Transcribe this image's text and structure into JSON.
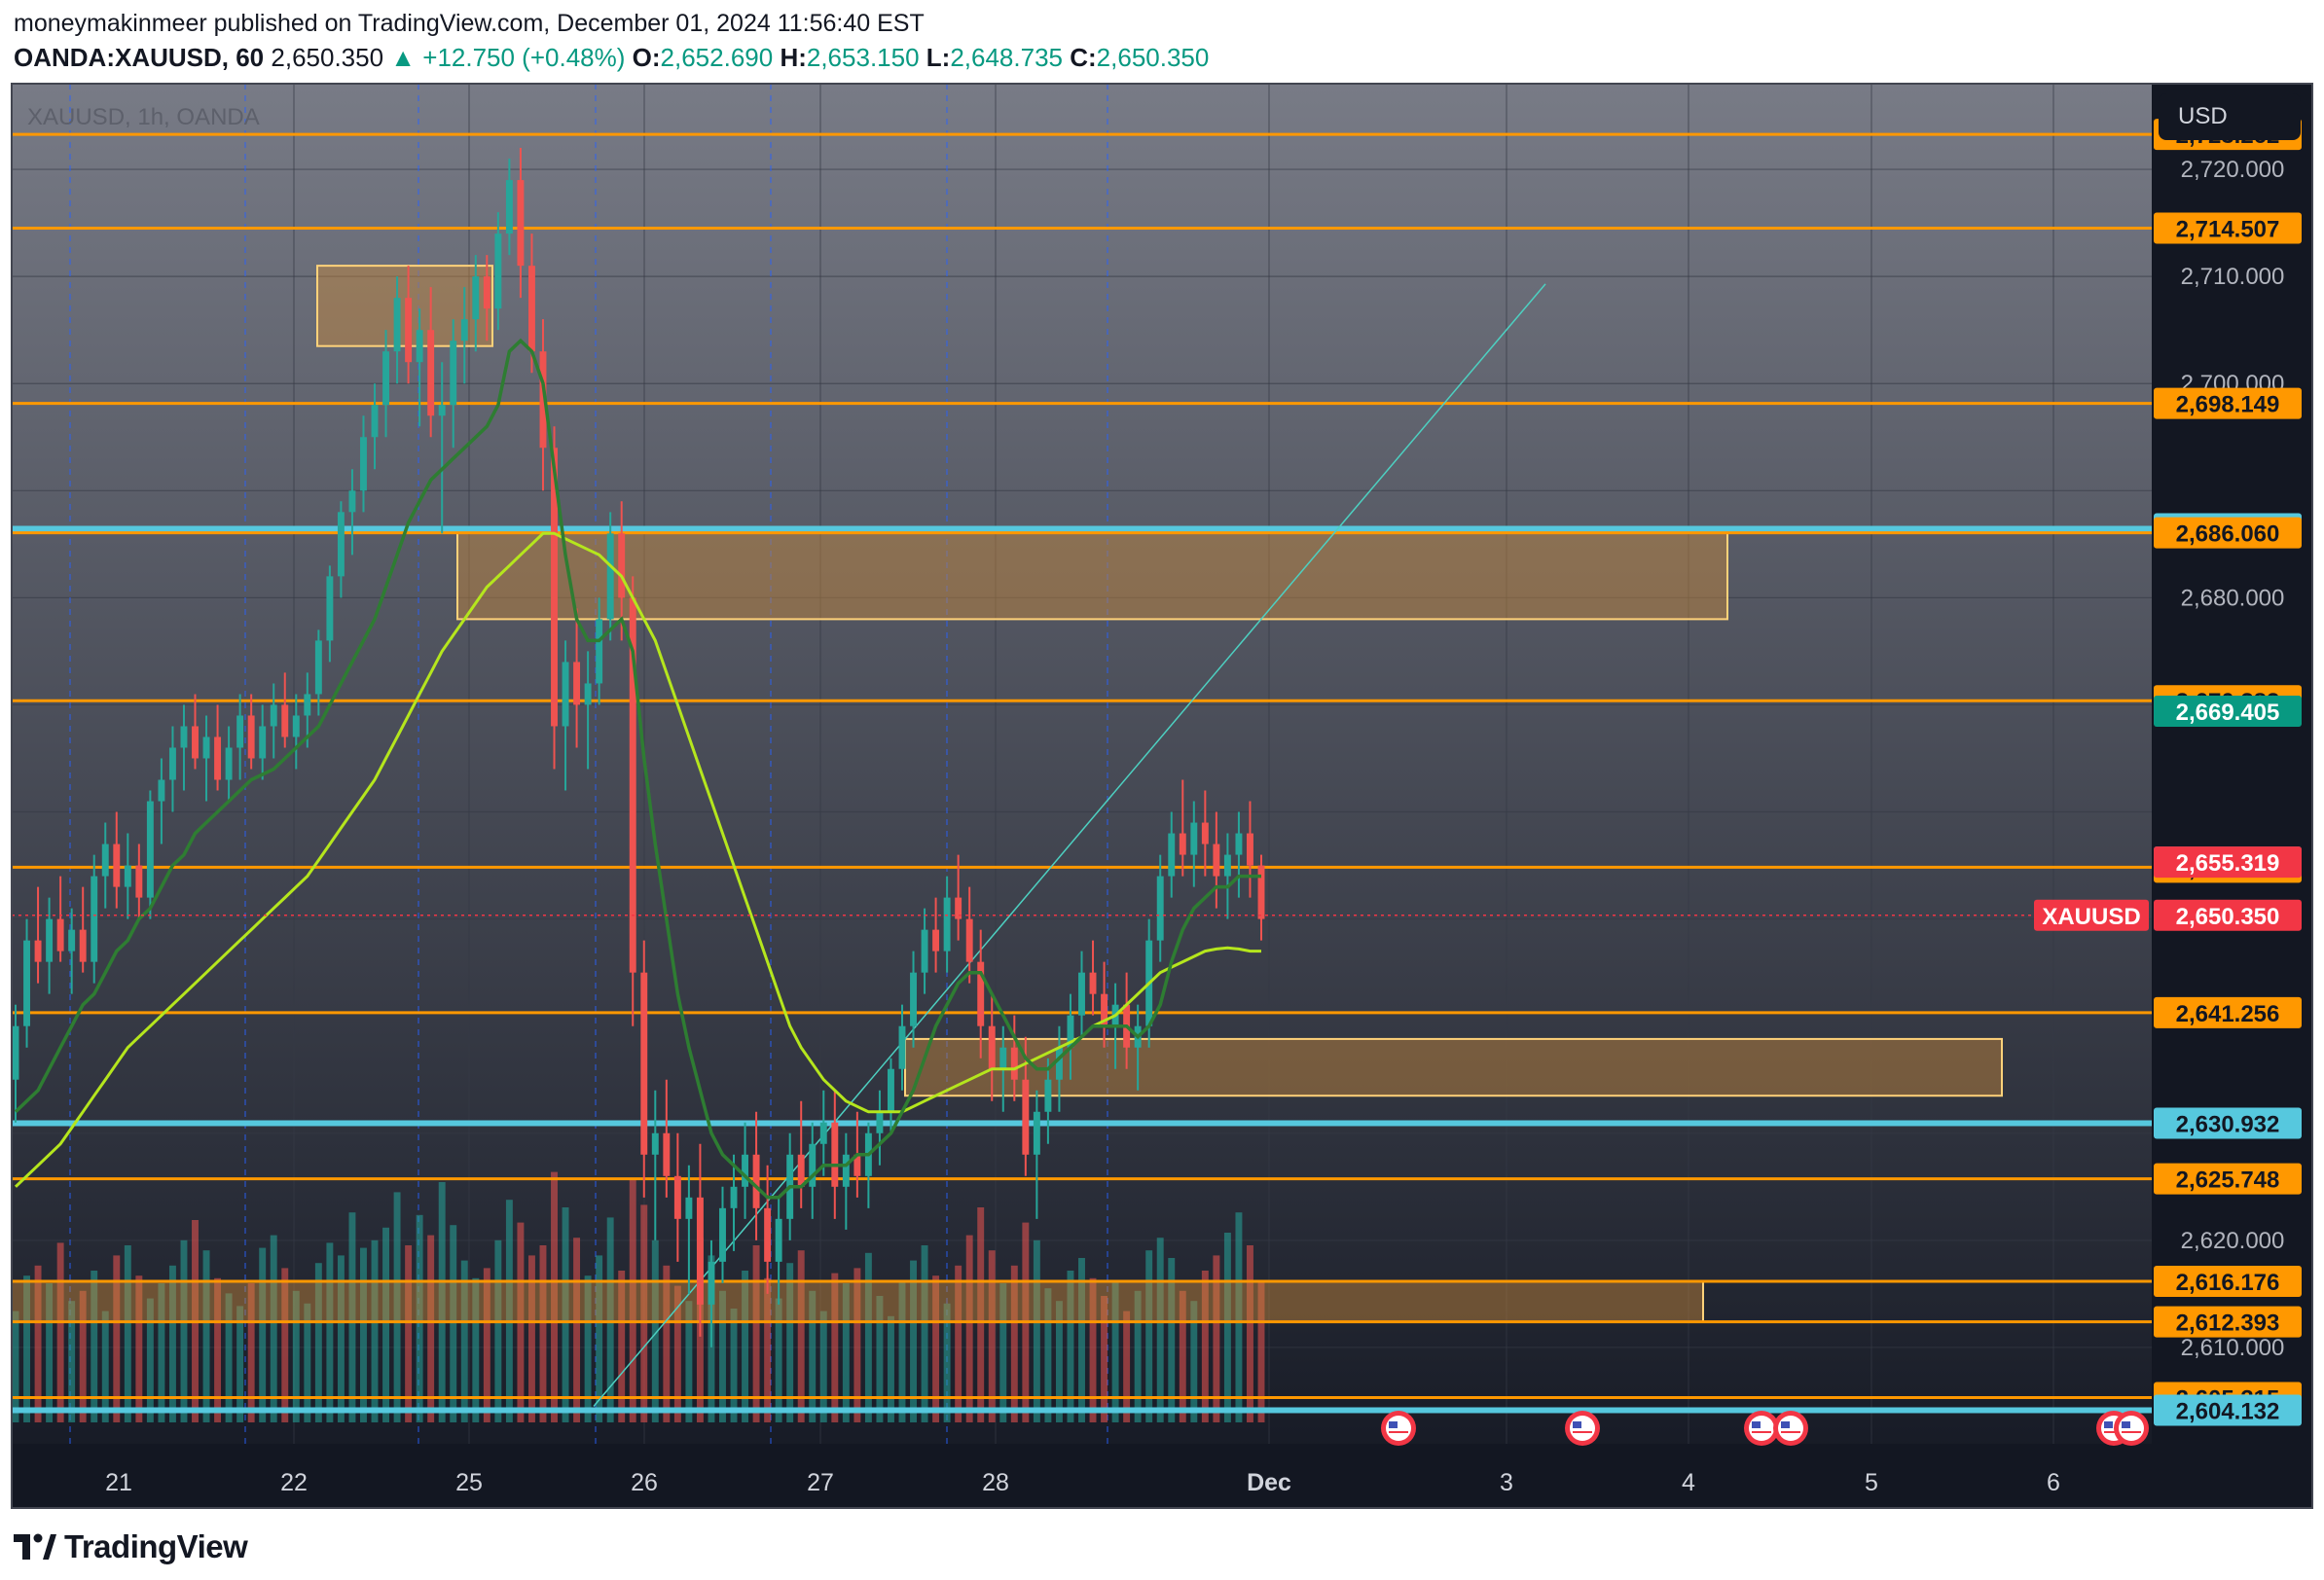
{
  "header": {
    "published": "moneymakinmeer published on TradingView.com, December 01, 2024 11:56:40 EST",
    "symbol": "OANDA:XAUUSD, 60",
    "last": "2,650.350",
    "change": "▲ +12.750 (+0.48%)",
    "o_label": "O:",
    "o_val": "2,652.690",
    "h_label": "H:",
    "h_val": "2,653.150",
    "l_label": "L:",
    "l_val": "2,648.735",
    "c_label": "C:",
    "c_val": "2,650.350"
  },
  "legend": {
    "title": "XAUUSD, 1h, OANDA"
  },
  "currency_button": "USD",
  "branding": {
    "logo_text": "TradingView"
  },
  "chart_data": {
    "type": "candlestick",
    "symbol": "XAUUSD",
    "interval": "1h",
    "broker": "OANDA",
    "colors": {
      "background_top": "#787b86",
      "background_bottom": "#131722",
      "up": "#26a69a",
      "down": "#ef5350",
      "support_line": "#ff9800",
      "key_line": "#56c8de",
      "zone": "#c9893b",
      "ma_fast": "#2e7d32",
      "ma_slow": "#b5e61d",
      "trendline": "#4dd0c1"
    },
    "ylim": [
      2601,
      2728
    ],
    "x_axis_labels": [
      "21",
      "22",
      "25",
      "26",
      "27",
      "28",
      "Dec",
      "3",
      "4",
      "5",
      "6"
    ],
    "y_axis_ticks": [
      "2,720.000",
      "2,710.000",
      "2,700.000",
      "2,680.000",
      "2,620.000",
      "2,610.000"
    ],
    "horizontal_levels": [
      {
        "label": "2,723.262",
        "value": 2723.262,
        "color": "#ff9800"
      },
      {
        "label": "2,714.507",
        "value": 2714.507,
        "color": "#ff9800"
      },
      {
        "label": "2,698.149",
        "value": 2698.149,
        "color": "#ff9800"
      },
      {
        "label": "2,686.444",
        "value": 2686.444,
        "color": "#56c8de"
      },
      {
        "label": "2,686.060",
        "value": 2686.06,
        "color": "#ff9800"
      },
      {
        "label": "2,670.383",
        "value": 2670.383,
        "color": "#ff9800"
      },
      {
        "label": "2,654.832",
        "value": 2654.832,
        "color": "#ff9800"
      },
      {
        "label": "2,641.256",
        "value": 2641.256,
        "color": "#ff9800"
      },
      {
        "label": "2,630.932",
        "value": 2630.932,
        "color": "#56c8de"
      },
      {
        "label": "2,625.748",
        "value": 2625.748,
        "color": "#ff9800"
      },
      {
        "label": "2,616.176",
        "value": 2616.176,
        "color": "#ff9800"
      },
      {
        "label": "2,612.393",
        "value": 2612.393,
        "color": "#ff9800"
      },
      {
        "label": "2,605.315",
        "value": 2605.315,
        "color": "#ff9800"
      },
      {
        "label": "2,604.132",
        "value": 2604.132,
        "color": "#56c8de"
      }
    ],
    "price_tags": [
      {
        "label": "2,669.405",
        "value": 2669.405,
        "color": "#089981"
      },
      {
        "label": "2,655.320",
        "value": 2655.32,
        "color": "#787b86"
      },
      {
        "label": "2,655.319",
        "value": 2655.319,
        "color": "#f23645"
      },
      {
        "label": "2,650.350",
        "value": 2650.35,
        "color": "#f23645",
        "name": "XAUUSD"
      }
    ],
    "zones": [
      {
        "x_from": "22",
        "x_to": "22",
        "y_from": 2703.5,
        "y_to": 2711.0
      },
      {
        "x_from": "25",
        "x_to": "4",
        "y_from": 2678.0,
        "y_to": 2686.2
      },
      {
        "x_from": "28",
        "x_to": "5",
        "y_from": 2633.5,
        "y_to": 2638.8
      },
      {
        "x_from": "21",
        "x_to": "4",
        "y_from": 2612.39,
        "y_to": 2616.18
      }
    ],
    "trendline": {
      "from": {
        "x": "26",
        "y": 2604.5
      },
      "to": {
        "x": "3",
        "y": 2709.3
      }
    },
    "candles": [
      [
        2635.0,
        2642.0,
        2631.0,
        2640.0
      ],
      [
        2640.0,
        2650.0,
        2638.0,
        2648.0
      ],
      [
        2648.0,
        2653.0,
        2644.0,
        2646.0
      ],
      [
        2646.0,
        2652.0,
        2643.0,
        2650.0
      ],
      [
        2650.0,
        2654.0,
        2646.0,
        2647.0
      ],
      [
        2647.0,
        2651.0,
        2643.0,
        2649.0
      ],
      [
        2649.0,
        2653.0,
        2645.0,
        2646.0
      ],
      [
        2646.0,
        2656.0,
        2644.0,
        2654.0
      ],
      [
        2654.0,
        2659.0,
        2651.0,
        2657.0
      ],
      [
        2657.0,
        2660.0,
        2651.0,
        2653.0
      ],
      [
        2653.0,
        2658.0,
        2650.0,
        2655.0
      ],
      [
        2655.0,
        2657.0,
        2650.0,
        2652.0
      ],
      [
        2652.0,
        2662.0,
        2650.0,
        2661.0
      ],
      [
        2661.0,
        2665.0,
        2657.0,
        2663.0
      ],
      [
        2663.0,
        2668.0,
        2660.0,
        2666.0
      ],
      [
        2666.0,
        2670.0,
        2662.0,
        2668.0
      ],
      [
        2668.0,
        2671.0,
        2664.0,
        2665.0
      ],
      [
        2665.0,
        2669.0,
        2661.0,
        2667.0
      ],
      [
        2667.0,
        2670.0,
        2662.0,
        2663.0
      ],
      [
        2663.0,
        2668.0,
        2661.0,
        2666.0
      ],
      [
        2666.0,
        2671.0,
        2663.0,
        2669.0
      ],
      [
        2669.0,
        2671.0,
        2664.0,
        2665.0
      ],
      [
        2665.0,
        2670.0,
        2663.0,
        2668.0
      ],
      [
        2668.0,
        2672.0,
        2665.0,
        2670.0
      ],
      [
        2670.0,
        2673.0,
        2666.0,
        2667.0
      ],
      [
        2667.0,
        2671.0,
        2664.0,
        2669.0
      ],
      [
        2669.0,
        2673.0,
        2666.0,
        2671.0
      ],
      [
        2671.0,
        2677.0,
        2669.0,
        2676.0
      ],
      [
        2676.0,
        2683.0,
        2674.0,
        2682.0
      ],
      [
        2682.0,
        2689.0,
        2680.0,
        2688.0
      ],
      [
        2688.0,
        2692.0,
        2684.0,
        2690.0
      ],
      [
        2690.0,
        2697.0,
        2688.0,
        2695.0
      ],
      [
        2695.0,
        2700.0,
        2692.0,
        2698.0
      ],
      [
        2698.0,
        2705.0,
        2695.0,
        2703.0
      ],
      [
        2703.0,
        2710.0,
        2700.0,
        2708.0
      ],
      [
        2708.0,
        2711.0,
        2700.0,
        2702.0
      ],
      [
        2702.0,
        2707.0,
        2696.0,
        2705.0
      ],
      [
        2705.0,
        2709.0,
        2695.0,
        2697.0
      ],
      [
        2697.0,
        2702.0,
        2686.0,
        2698.0
      ],
      [
        2698.0,
        2706.0,
        2694.0,
        2704.0
      ],
      [
        2704.0,
        2709.0,
        2700.0,
        2706.0
      ],
      [
        2706.0,
        2712.0,
        2703.0,
        2710.0
      ],
      [
        2710.0,
        2712.0,
        2704.0,
        2707.0
      ],
      [
        2707.0,
        2716.0,
        2705.0,
        2714.0
      ],
      [
        2714.0,
        2721.0,
        2712.0,
        2719.0
      ],
      [
        2719.0,
        2722.0,
        2708.0,
        2711.0
      ],
      [
        2711.0,
        2714.0,
        2701.0,
        2703.0
      ],
      [
        2703.0,
        2706.0,
        2690.0,
        2694.0
      ],
      [
        2694.0,
        2696.0,
        2664.0,
        2668.0
      ],
      [
        2668.0,
        2676.0,
        2662.0,
        2674.0
      ],
      [
        2674.0,
        2679.0,
        2666.0,
        2670.0
      ],
      [
        2670.0,
        2675.0,
        2664.0,
        2672.0
      ],
      [
        2672.0,
        2680.0,
        2670.0,
        2678.0
      ],
      [
        2678.0,
        2688.0,
        2676.0,
        2686.0
      ],
      [
        2686.0,
        2689.0,
        2676.0,
        2680.0
      ],
      [
        2680.0,
        2682.0,
        2640.0,
        2645.0
      ],
      [
        2645.0,
        2648.0,
        2624.0,
        2628.0
      ],
      [
        2628.0,
        2634.0,
        2620.0,
        2630.0
      ],
      [
        2630.0,
        2635.0,
        2624.0,
        2626.0
      ],
      [
        2626.0,
        2630.0,
        2618.0,
        2622.0
      ],
      [
        2622.0,
        2627.0,
        2615.0,
        2624.0
      ],
      [
        2624.0,
        2629.0,
        2611.0,
        2614.0
      ],
      [
        2614.0,
        2620.0,
        2610.0,
        2618.0
      ],
      [
        2618.0,
        2625.0,
        2616.0,
        2623.0
      ],
      [
        2623.0,
        2628.0,
        2619.0,
        2625.0
      ],
      [
        2625.0,
        2631.0,
        2622.0,
        2628.0
      ],
      [
        2628.0,
        2632.0,
        2620.0,
        2623.0
      ],
      [
        2623.0,
        2627.0,
        2615.0,
        2618.0
      ],
      [
        2618.0,
        2624.0,
        2614.0,
        2622.0
      ],
      [
        2622.0,
        2630.0,
        2620.0,
        2628.0
      ],
      [
        2628.0,
        2633.0,
        2623.0,
        2625.0
      ],
      [
        2625.0,
        2631.0,
        2622.0,
        2629.0
      ],
      [
        2629.0,
        2634.0,
        2626.0,
        2631.0
      ],
      [
        2631.0,
        2634.0,
        2622.0,
        2625.0
      ],
      [
        2625.0,
        2630.0,
        2621.0,
        2628.0
      ],
      [
        2628.0,
        2632.0,
        2624.0,
        2626.0
      ],
      [
        2626.0,
        2631.0,
        2623.0,
        2630.0
      ],
      [
        2630.0,
        2634.0,
        2627.0,
        2632.0
      ],
      [
        2632.0,
        2637.0,
        2630.0,
        2636.0
      ],
      [
        2636.0,
        2642.0,
        2634.0,
        2640.0
      ],
      [
        2640.0,
        2647.0,
        2638.0,
        2645.0
      ],
      [
        2645.0,
        2651.0,
        2643.0,
        2649.0
      ],
      [
        2649.0,
        2652.0,
        2645.0,
        2647.0
      ],
      [
        2647.0,
        2654.0,
        2645.0,
        2652.0
      ],
      [
        2652.0,
        2656.0,
        2648.0,
        2650.0
      ],
      [
        2650.0,
        2653.0,
        2644.0,
        2646.0
      ],
      [
        2646.0,
        2649.0,
        2637.0,
        2640.0
      ],
      [
        2640.0,
        2643.0,
        2633.0,
        2636.0
      ],
      [
        2636.0,
        2640.0,
        2632.0,
        2638.0
      ],
      [
        2638.0,
        2641.0,
        2633.0,
        2635.0
      ],
      [
        2635.0,
        2639.0,
        2626.0,
        2628.0
      ],
      [
        2628.0,
        2634.0,
        2622.0,
        2632.0
      ],
      [
        2632.0,
        2637.0,
        2629.0,
        2635.0
      ],
      [
        2635.0,
        2640.0,
        2632.0,
        2638.0
      ],
      [
        2638.0,
        2643.0,
        2635.0,
        2641.0
      ],
      [
        2641.0,
        2647.0,
        2639.0,
        2645.0
      ],
      [
        2645.0,
        2648.0,
        2641.0,
        2643.0
      ],
      [
        2643.0,
        2646.0,
        2638.0,
        2640.0
      ],
      [
        2640.0,
        2644.0,
        2636.0,
        2642.0
      ],
      [
        2642.0,
        2645.0,
        2636.0,
        2638.0
      ],
      [
        2638.0,
        2642.0,
        2634.0,
        2640.0
      ],
      [
        2640.0,
        2650.0,
        2638.0,
        2648.0
      ],
      [
        2648.0,
        2656.0,
        2646.0,
        2654.0
      ],
      [
        2654.0,
        2660.0,
        2652.0,
        2658.0
      ],
      [
        2658.0,
        2663.0,
        2654.0,
        2656.0
      ],
      [
        2656.0,
        2661.0,
        2653.0,
        2659.0
      ],
      [
        2659.0,
        2662.0,
        2654.0,
        2657.0
      ],
      [
        2657.0,
        2660.0,
        2651.0,
        2654.0
      ],
      [
        2654.0,
        2658.0,
        2650.0,
        2656.0
      ],
      [
        2656.0,
        2660.0,
        2652.0,
        2658.0
      ],
      [
        2658.0,
        2661.0,
        2652.0,
        2655.0
      ],
      [
        2655.0,
        2656.0,
        2648.0,
        2650.0
      ]
    ],
    "volume": [
      0.44,
      0.58,
      0.62,
      0.55,
      0.71,
      0.48,
      0.52,
      0.6,
      0.44,
      0.66,
      0.7,
      0.58,
      0.49,
      0.55,
      0.62,
      0.72,
      0.8,
      0.68,
      0.57,
      0.51,
      0.46,
      0.55,
      0.69,
      0.74,
      0.61,
      0.52,
      0.47,
      0.63,
      0.71,
      0.66,
      0.83,
      0.69,
      0.72,
      0.77,
      0.91,
      0.7,
      0.82,
      0.74,
      0.95,
      0.78,
      0.64,
      0.57,
      0.61,
      0.72,
      0.88,
      0.79,
      0.66,
      0.7,
      0.99,
      0.85,
      0.73,
      0.58,
      0.66,
      0.81,
      0.6,
      0.96,
      0.86,
      0.72,
      0.62,
      0.54,
      0.48,
      0.73,
      0.66,
      0.52,
      0.45,
      0.6,
      0.7,
      0.57,
      0.49,
      0.63,
      0.68,
      0.52,
      0.44,
      0.59,
      0.55,
      0.61,
      0.67,
      0.5,
      0.42,
      0.56,
      0.64,
      0.7,
      0.58,
      0.47,
      0.62,
      0.74,
      0.85,
      0.68,
      0.55,
      0.62,
      0.79,
      0.72,
      0.53,
      0.48,
      0.6,
      0.65,
      0.57,
      0.5,
      0.56,
      0.44,
      0.52,
      0.68,
      0.73,
      0.65,
      0.52,
      0.48,
      0.6,
      0.66,
      0.75,
      0.83,
      0.7,
      0.56
    ],
    "ma_fast": [
      2632.0,
      2633.0,
      2634.0,
      2636.0,
      2638.0,
      2640.0,
      2642.0,
      2643.0,
      2645.0,
      2647.0,
      2648.0,
      2650.0,
      2651.0,
      2653.0,
      2655.0,
      2656.0,
      2658.0,
      2659.0,
      2660.0,
      2661.0,
      2662.0,
      2663.0,
      2663.5,
      2664.0,
      2665.0,
      2666.0,
      2667.0,
      2668.0,
      2670.0,
      2672.0,
      2674.0,
      2676.0,
      2678.0,
      2681.0,
      2684.0,
      2687.0,
      2689.0,
      2691.0,
      2692.0,
      2693.0,
      2694.0,
      2695.0,
      2696.0,
      2698.0,
      2703.0,
      2704.0,
      2703.0,
      2700.0,
      2692.0,
      2684.0,
      2678.0,
      2676.0,
      2676.0,
      2677.0,
      2678.0,
      2675.0,
      2665.0,
      2657.0,
      2650.0,
      2643.0,
      2638.0,
      2634.0,
      2630.0,
      2628.0,
      2627.0,
      2626.0,
      2625.0,
      2624.0,
      2624.0,
      2625.0,
      2625.0,
      2626.0,
      2627.0,
      2627.0,
      2627.0,
      2628.0,
      2628.0,
      2629.0,
      2630.0,
      2632.0,
      2634.0,
      2637.0,
      2640.0,
      2642.0,
      2644.0,
      2645.0,
      2645.0,
      2643.0,
      2641.0,
      2639.0,
      2637.0,
      2636.0,
      2636.0,
      2637.0,
      2638.0,
      2639.0,
      2640.0,
      2640.0,
      2640.0,
      2640.0,
      2639.0,
      2640.0,
      2642.0,
      2646.0,
      2649.0,
      2651.0,
      2652.0,
      2653.0,
      2653.0,
      2654.0,
      2654.0,
      2654.0
    ],
    "ma_slow": [
      2625.0,
      2626.0,
      2627.0,
      2628.0,
      2629.0,
      2630.5,
      2632.0,
      2633.5,
      2635.0,
      2636.5,
      2638.0,
      2639.0,
      2640.0,
      2641.0,
      2642.0,
      2643.0,
      2644.0,
      2645.0,
      2646.0,
      2647.0,
      2648.0,
      2649.0,
      2650.0,
      2651.0,
      2652.0,
      2653.0,
      2654.0,
      2655.5,
      2657.0,
      2658.5,
      2660.0,
      2661.5,
      2663.0,
      2665.0,
      2667.0,
      2669.0,
      2671.0,
      2673.0,
      2675.0,
      2676.5,
      2678.0,
      2679.5,
      2681.0,
      2682.0,
      2683.0,
      2684.0,
      2685.0,
      2686.0,
      2686.0,
      2685.5,
      2685.0,
      2684.5,
      2684.0,
      2683.0,
      2682.0,
      2680.0,
      2678.0,
      2676.0,
      2673.0,
      2670.0,
      2667.0,
      2664.0,
      2661.0,
      2658.0,
      2655.0,
      2652.0,
      2649.0,
      2646.0,
      2643.0,
      2640.0,
      2638.0,
      2636.5,
      2635.0,
      2634.0,
      2633.0,
      2632.5,
      2632.0,
      2632.0,
      2632.0,
      2632.0,
      2632.5,
      2633.0,
      2633.5,
      2634.0,
      2634.5,
      2635.0,
      2635.5,
      2636.0,
      2636.0,
      2636.0,
      2636.5,
      2637.0,
      2637.5,
      2638.0,
      2638.5,
      2639.0,
      2640.0,
      2640.5,
      2641.0,
      2642.0,
      2643.0,
      2644.0,
      2645.0,
      2645.5,
      2646.0,
      2646.5,
      2647.0,
      2647.2,
      2647.3,
      2647.2,
      2647.0,
      2647.0
    ]
  }
}
